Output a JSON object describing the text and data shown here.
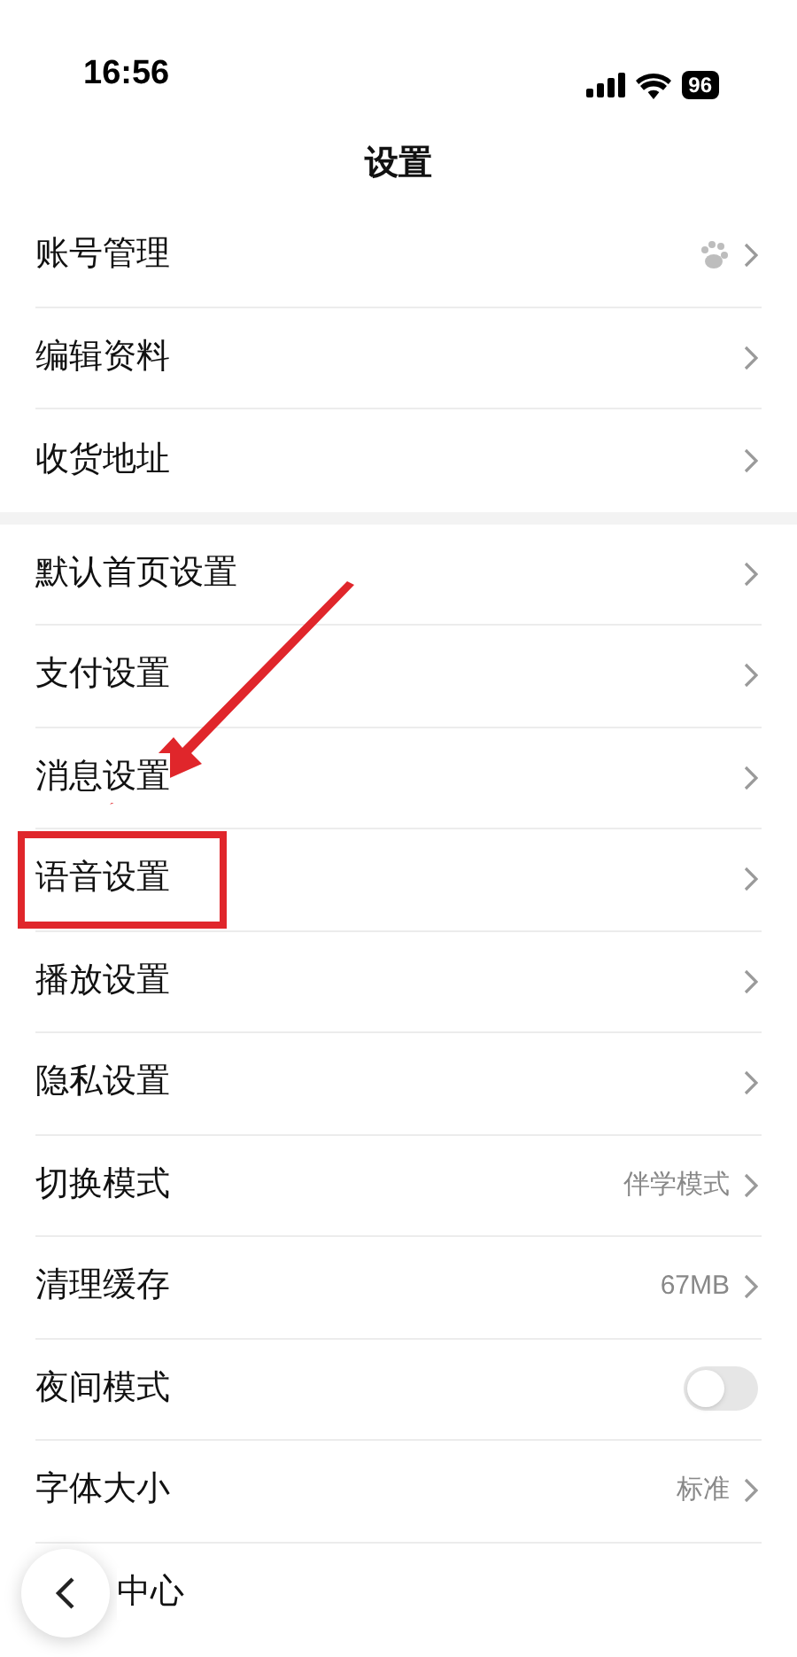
{
  "status_bar": {
    "time": "16:56",
    "battery": "96"
  },
  "title": "设置",
  "sections": [
    {
      "rows": [
        {
          "label": "账号管理",
          "kind": "account"
        },
        {
          "label": "编辑资料",
          "kind": "link"
        },
        {
          "label": "收货地址",
          "kind": "link"
        }
      ]
    },
    {
      "rows": [
        {
          "label": "默认首页设置",
          "kind": "link"
        },
        {
          "label": "支付设置",
          "kind": "link"
        },
        {
          "label": "消息设置",
          "kind": "link"
        },
        {
          "label": "语音设置",
          "kind": "link",
          "highlighted": true
        },
        {
          "label": "播放设置",
          "kind": "link"
        },
        {
          "label": "隐私设置",
          "kind": "link"
        },
        {
          "label": "切换模式",
          "kind": "link",
          "value": "伴学模式"
        },
        {
          "label": "清理缓存",
          "kind": "link",
          "value": "67MB"
        },
        {
          "label": "夜间模式",
          "kind": "toggle",
          "on": false
        },
        {
          "label": "字体大小",
          "kind": "link",
          "value": "标准"
        },
        {
          "label": "中心",
          "kind": "partial"
        }
      ]
    }
  ]
}
